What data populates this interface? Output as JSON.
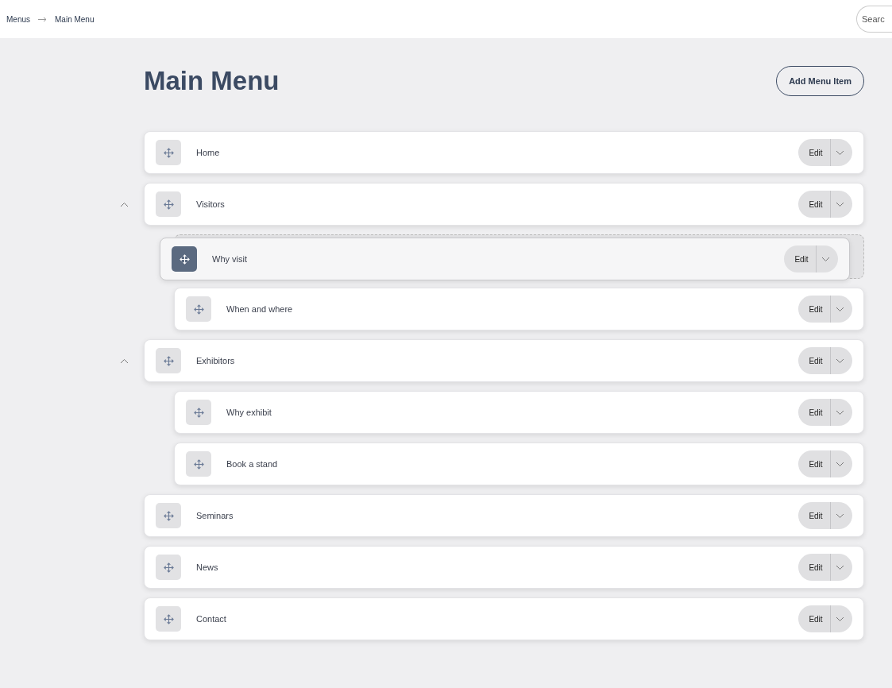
{
  "breadcrumb": [
    {
      "label": "Menus"
    },
    {
      "label": "Main Menu"
    }
  ],
  "search": {
    "placeholder": "Searc"
  },
  "title": "Main Menu",
  "add_button": "Add Menu Item",
  "items": [
    {
      "label": "Home",
      "edit": "Edit",
      "dragging": false
    },
    {
      "label": "Visitors",
      "edit": "Edit",
      "dragging": false,
      "expanded": true,
      "children": [
        {
          "label": "Why visit",
          "edit": "Edit",
          "dragging": true
        },
        {
          "label": "When and where",
          "edit": "Edit",
          "dragging": false
        }
      ]
    },
    {
      "label": "Exhibitors",
      "edit": "Edit",
      "dragging": false,
      "expanded": true,
      "children": [
        {
          "label": "Why exhibit",
          "edit": "Edit",
          "dragging": false
        },
        {
          "label": "Book a stand",
          "edit": "Edit",
          "dragging": false
        }
      ]
    },
    {
      "label": "Seminars",
      "edit": "Edit",
      "dragging": false
    },
    {
      "label": "News",
      "edit": "Edit",
      "dragging": false
    },
    {
      "label": "Contact",
      "edit": "Edit",
      "dragging": false
    }
  ]
}
